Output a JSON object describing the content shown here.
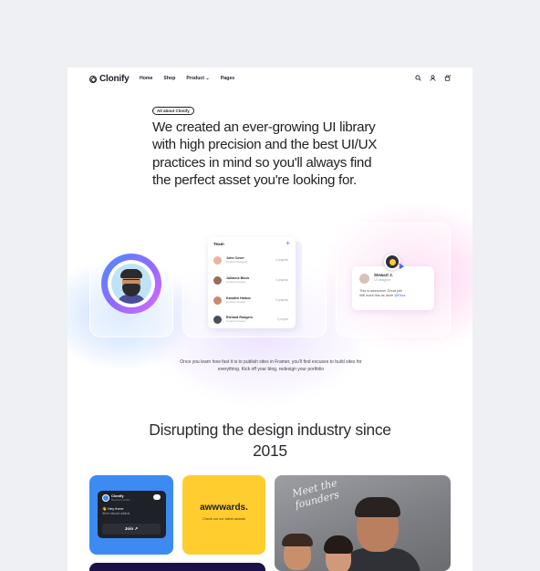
{
  "nav": {
    "logo": "Clonify",
    "links": [
      "Home",
      "Shop",
      "Product",
      "Pages"
    ],
    "icons": [
      "search-icon",
      "user-icon",
      "cart-icon"
    ]
  },
  "hero": {
    "badge": "All about Clonify",
    "headline": "We created an ever-growing UI library with high precision and the best UI/UX practices in mind so you'll always find the perfect asset you're looking for.",
    "paragraph": "Once you learn how fast it is to publish sites in Framer, you'll find excuses to build sites for everything. Kick off your blog, redesign your portfolio"
  },
  "team": {
    "title": "Team",
    "members": [
      {
        "name": "John Cover",
        "role": "Product Designer",
        "projects": "4 projects",
        "color": "#e8b4a0"
      },
      {
        "name": "Julianne Block",
        "role": "Content Creator",
        "projects": "4 projects",
        "color": "#9a6b58"
      },
      {
        "name": "Kamden Harbor",
        "role": "Content Creator",
        "projects": "3 projects",
        "color": "#c98a70"
      },
      {
        "name": "Richard Rodgers",
        "role": "Content Creator",
        "projects": "1 project",
        "color": "#4a4f60"
      }
    ]
  },
  "comment": {
    "name": "Stewart J.",
    "role": "UI designer",
    "text_a": "This is awesome! Great job!",
    "text_b": "Will mark this as done",
    "mention": "@Elisa"
  },
  "section2": {
    "title": "Disrupting the design industry since 2015"
  },
  "discord_card": {
    "name": "Clonify",
    "sub": "Members Online",
    "hey": "👋 Hey there",
    "message": "We're discord addicts",
    "button": "Join ↗"
  },
  "awwwards_card": {
    "title": "awwwards.",
    "subtitle": "Check out our latest awards"
  },
  "founders_card": {
    "script": "Meet the\nfounders"
  },
  "colors": {
    "accent": "#4a6cf7",
    "tile_blue": "#3d8bf2",
    "tile_yellow": "#ffcd2e",
    "tile_dark": "#1c1248"
  }
}
